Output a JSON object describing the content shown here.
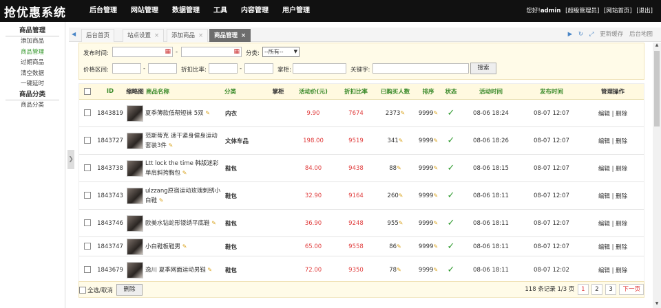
{
  "app": {
    "logo": "抢优惠系统",
    "nav": [
      "后台管理",
      "网站管理",
      "数据管理",
      "工具",
      "内容管理",
      "用户管理"
    ],
    "user": {
      "greeting": "您好!",
      "name": "admin",
      "role": "[超级管理员]",
      "home": "[网站首页]",
      "logout": "[退出]"
    }
  },
  "sidebar": {
    "sections": [
      {
        "title": "商品管理",
        "items": [
          "添加商品",
          "商品管理",
          "过期商品",
          "清空数据",
          "一键延时"
        ]
      },
      {
        "title": "商品分类",
        "items": [
          "商品分类"
        ]
      }
    ]
  },
  "tabs": {
    "items": [
      "后台首页",
      "站点设置",
      "添加商品",
      "商品管理"
    ],
    "tools": [
      "更新缓存",
      "后台地图"
    ]
  },
  "filter": {
    "publish_time": "发布时间:",
    "dash": "-",
    "category": "分类:",
    "category_value": "--所有--",
    "price_range": "价格区间:",
    "discount": "折扣比率:",
    "shop": "掌柜:",
    "keyword": "关键字:",
    "search": "搜索"
  },
  "table": {
    "headers": [
      "ID",
      "缩略图",
      "商品名称",
      "分类",
      "掌柜",
      "活动价(元)",
      "折扣比率",
      "已购买人数",
      "排序",
      "状态",
      "活动时间",
      "发布时间",
      "管理操作"
    ],
    "action_edit": "编辑",
    "action_sep": "|",
    "action_delete": "删除",
    "rows": [
      {
        "id": "1843819",
        "name": "夏季薄款低帮短袜 5双",
        "category": "内衣",
        "shop": "",
        "price": "9.90",
        "ratio": "7674",
        "buyers": "2373",
        "sort": "9999",
        "active_time": "08-06 18:24",
        "publish_time": "08-07 12:07"
      },
      {
        "id": "1843727",
        "name": "范斯蒂克 速干紧身健身运动套装3件",
        "category": "文体车品",
        "shop": "",
        "price": "198.00",
        "ratio": "9519",
        "buyers": "341",
        "sort": "9999",
        "active_time": "08-06 18:26",
        "publish_time": "08-07 12:07"
      },
      {
        "id": "1843738",
        "name": "Ltt lock the time 韩版迷彩单肩斜挎胸包",
        "category": "鞋包",
        "shop": "",
        "price": "84.00",
        "ratio": "9438",
        "buyers": "88",
        "sort": "9999",
        "active_time": "08-06 18:15",
        "publish_time": "08-07 12:07"
      },
      {
        "id": "1843743",
        "name": "ulzzang原宿运动玫瑰刺绣小白鞋",
        "category": "鞋包",
        "shop": "",
        "price": "32.90",
        "ratio": "9164",
        "buyers": "260",
        "sort": "9999",
        "active_time": "08-06 18:11",
        "publish_time": "08-07 12:07"
      },
      {
        "id": "1843746",
        "name": "欧美水钻蛇形镂绣平底鞋",
        "category": "鞋包",
        "shop": "",
        "price": "36.90",
        "ratio": "9248",
        "buyers": "955",
        "sort": "9999",
        "active_time": "08-06 18:11",
        "publish_time": "08-07 12:07"
      },
      {
        "id": "1843747",
        "name": "小白鞋板鞋男",
        "category": "鞋包",
        "shop": "",
        "price": "65.00",
        "ratio": "9558",
        "buyers": "86",
        "sort": "9999",
        "active_time": "08-06 18:11",
        "publish_time": "08-07 12:07"
      },
      {
        "id": "1843679",
        "name": "逸川 夏季网面运动男鞋",
        "category": "鞋包",
        "shop": "",
        "price": "72.00",
        "ratio": "9350",
        "buyers": "78",
        "sort": "9999",
        "active_time": "08-06 18:11",
        "publish_time": "08-07 12:02"
      }
    ]
  },
  "bottom": {
    "select_all": "全选/取消",
    "delete": "删除",
    "records": "118 条记录 1/3 页",
    "pages": [
      "1",
      "2",
      "3"
    ],
    "next": "下一页"
  },
  "colors": {
    "accent": "#3a8a2a",
    "price": "#e03c3c",
    "topbar": "#111111"
  }
}
